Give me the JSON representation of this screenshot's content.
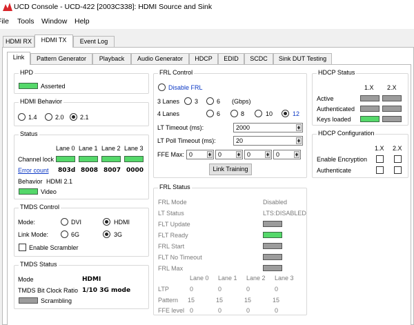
{
  "window": {
    "title": "UCD Console - UCD-422 [2003C338]: HDMI Source and Sink"
  },
  "menu": [
    "File",
    "Tools",
    "Window",
    "Help"
  ],
  "top_tabs": [
    {
      "label": "HDMI RX",
      "active": false
    },
    {
      "label": "HDMI TX",
      "active": true
    },
    {
      "label": "Event Log",
      "active": false
    }
  ],
  "sub_tabs": [
    {
      "label": "Link",
      "active": true
    },
    {
      "label": "Pattern Generator",
      "active": false
    },
    {
      "label": "Playback",
      "active": false
    },
    {
      "label": "Audio Generator",
      "active": false
    },
    {
      "label": "HDCP",
      "active": false
    },
    {
      "label": "EDID",
      "active": false
    },
    {
      "label": "SCDC",
      "active": false
    },
    {
      "label": "Sink DUT Testing",
      "active": false
    }
  ],
  "hpd": {
    "title": "HPD",
    "state_label": "Asserted",
    "led": "on"
  },
  "hdmi_behavior": {
    "title": "HDMI Behavior",
    "options": [
      {
        "label": "1.4",
        "checked": false
      },
      {
        "label": "2.0",
        "checked": false
      },
      {
        "label": "2.1",
        "checked": true
      }
    ]
  },
  "status": {
    "title": "Status",
    "lane_headers": [
      "Lane 0",
      "Lane 1",
      "Lane 2",
      "Lane 3"
    ],
    "channel_lock_label": "Channel lock",
    "channel_lock_leds": [
      "on",
      "on",
      "on",
      "on"
    ],
    "error_count_label": "Error count",
    "error_counts": [
      "803d",
      "8008",
      "8007",
      "0000"
    ],
    "behavior_label": "Behavior",
    "behavior_value": "HDMI 2.1",
    "video_label": "Video",
    "video_led": "on"
  },
  "tmds_control": {
    "title": "TMDS Control",
    "mode_label": "Mode:",
    "mode_options": [
      {
        "label": "DVI",
        "checked": false
      },
      {
        "label": "HDMI",
        "checked": true
      }
    ],
    "link_mode_label": "Link Mode:",
    "link_mode_options": [
      {
        "label": "6G",
        "checked": false
      },
      {
        "label": "3G",
        "checked": true
      }
    ],
    "scrambler_label": "Enable Scrambler",
    "scrambler_checked": false
  },
  "tmds_status": {
    "title": "TMDS Status",
    "mode_label": "Mode",
    "mode_value": "HDMI",
    "ratio_label": "TMDS Bit Clock Ratio",
    "ratio_value": "1/10 3G mode",
    "scrambling_label": "Scrambling",
    "scrambling_led": "off"
  },
  "frl_control": {
    "title": "FRL Control",
    "disable_label": "Disable FRL",
    "disable_checked": false,
    "lanes3_label": "3 Lanes",
    "lanes3_options": [
      {
        "label": "3",
        "checked": false
      },
      {
        "label": "6",
        "checked": false
      }
    ],
    "gbps_label": "(Gbps)",
    "lanes4_label": "4 Lanes",
    "lanes4_options": [
      {
        "label": "6",
        "checked": false
      },
      {
        "label": "8",
        "checked": false
      },
      {
        "label": "10",
        "checked": false
      },
      {
        "label": "12",
        "checked": true
      }
    ],
    "lt_timeout_label": "LT Timeout (ms):",
    "lt_timeout_value": "2000",
    "lt_poll_label": "LT Poll Timeout (ms):",
    "lt_poll_value": "20",
    "ffe_label": "FFE Max:",
    "ffe_values": [
      "0",
      "0",
      "0",
      "0"
    ],
    "button_label": "Link Training"
  },
  "frl_status": {
    "title": "FRL Status",
    "frl_mode_label": "FRL Mode",
    "frl_mode_value": "Disabled",
    "lt_status_label": "LT Status",
    "lt_status_value": "LTS:DISABLED",
    "indicators": [
      {
        "label": "FLT Update",
        "led": "off"
      },
      {
        "label": "FLT Ready",
        "led": "on"
      },
      {
        "label": "FRL Start",
        "led": "off"
      },
      {
        "label": "FLT No Timeout",
        "led": "off"
      },
      {
        "label": "FRL Max",
        "led": "off"
      }
    ],
    "lane_headers": [
      "Lane 0",
      "Lane 1",
      "Lane 2",
      "Lane 3"
    ],
    "rows": [
      {
        "label": "LTP",
        "values": [
          "0",
          "0",
          "0",
          "0"
        ]
      },
      {
        "label": "Pattern",
        "values": [
          "15",
          "15",
          "15",
          "15"
        ]
      },
      {
        "label": "FFE level",
        "values": [
          "0",
          "0",
          "0",
          "0"
        ]
      }
    ]
  },
  "hdcp_status": {
    "title": "HDCP Status",
    "col_headers": [
      "1.X",
      "2.X"
    ],
    "rows": [
      {
        "label": "Active",
        "leds": [
          "off",
          "off"
        ]
      },
      {
        "label": "Authenticated",
        "leds": [
          "off",
          "off"
        ]
      },
      {
        "label": "Keys loaded",
        "leds": [
          "on",
          "off"
        ]
      }
    ]
  },
  "hdcp_config": {
    "title": "HDCP Configuration",
    "col_headers": [
      "1.X",
      "2.X"
    ],
    "rows": [
      {
        "label": "Enable Encryption",
        "checks": [
          false,
          false
        ]
      },
      {
        "label": "Authenticate",
        "checks": [
          false,
          false
        ]
      }
    ]
  }
}
